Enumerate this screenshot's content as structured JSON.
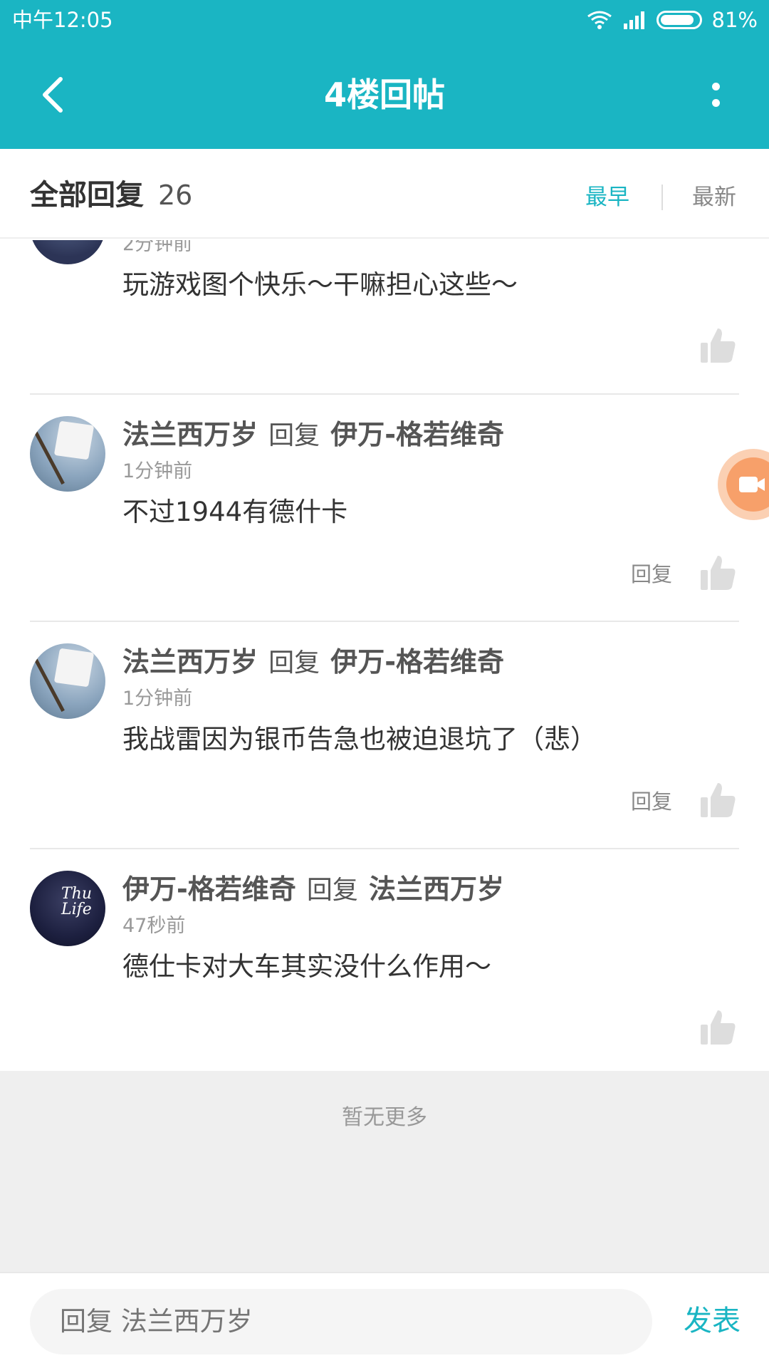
{
  "status": {
    "time": "中午12:05",
    "battery": "81%"
  },
  "header": {
    "title": "4楼回帖"
  },
  "sort": {
    "label": "全部回复",
    "count": "26",
    "earliest": "最早",
    "latest": "最新"
  },
  "replies": [
    {
      "time": "2分钟前",
      "text": "玩游戏图个快乐～干嘛担心这些～"
    },
    {
      "author": "法兰西万岁",
      "reply_word": "回复",
      "target": "伊万-格若维奇",
      "time": "1分钟前",
      "text": "不过1944有德什卡",
      "reply_label": "回复"
    },
    {
      "author": "法兰西万岁",
      "reply_word": "回复",
      "target": "伊万-格若维奇",
      "time": "1分钟前",
      "text": "我战雷因为银币告急也被迫退坑了（悲）",
      "reply_label": "回复"
    },
    {
      "author": "伊万-格若维奇",
      "reply_word": "回复",
      "target": "法兰西万岁",
      "time": "47秒前",
      "text": "德仕卡对大车其实没什么作用～",
      "avatar_text": "Thu Life"
    }
  ],
  "footer": {
    "no_more": "暂无更多"
  },
  "bottom": {
    "placeholder": "回复 法兰西万岁",
    "send": "发表"
  },
  "colors": {
    "accent": "#1ab5c3",
    "float_button": "#f7a06a"
  }
}
